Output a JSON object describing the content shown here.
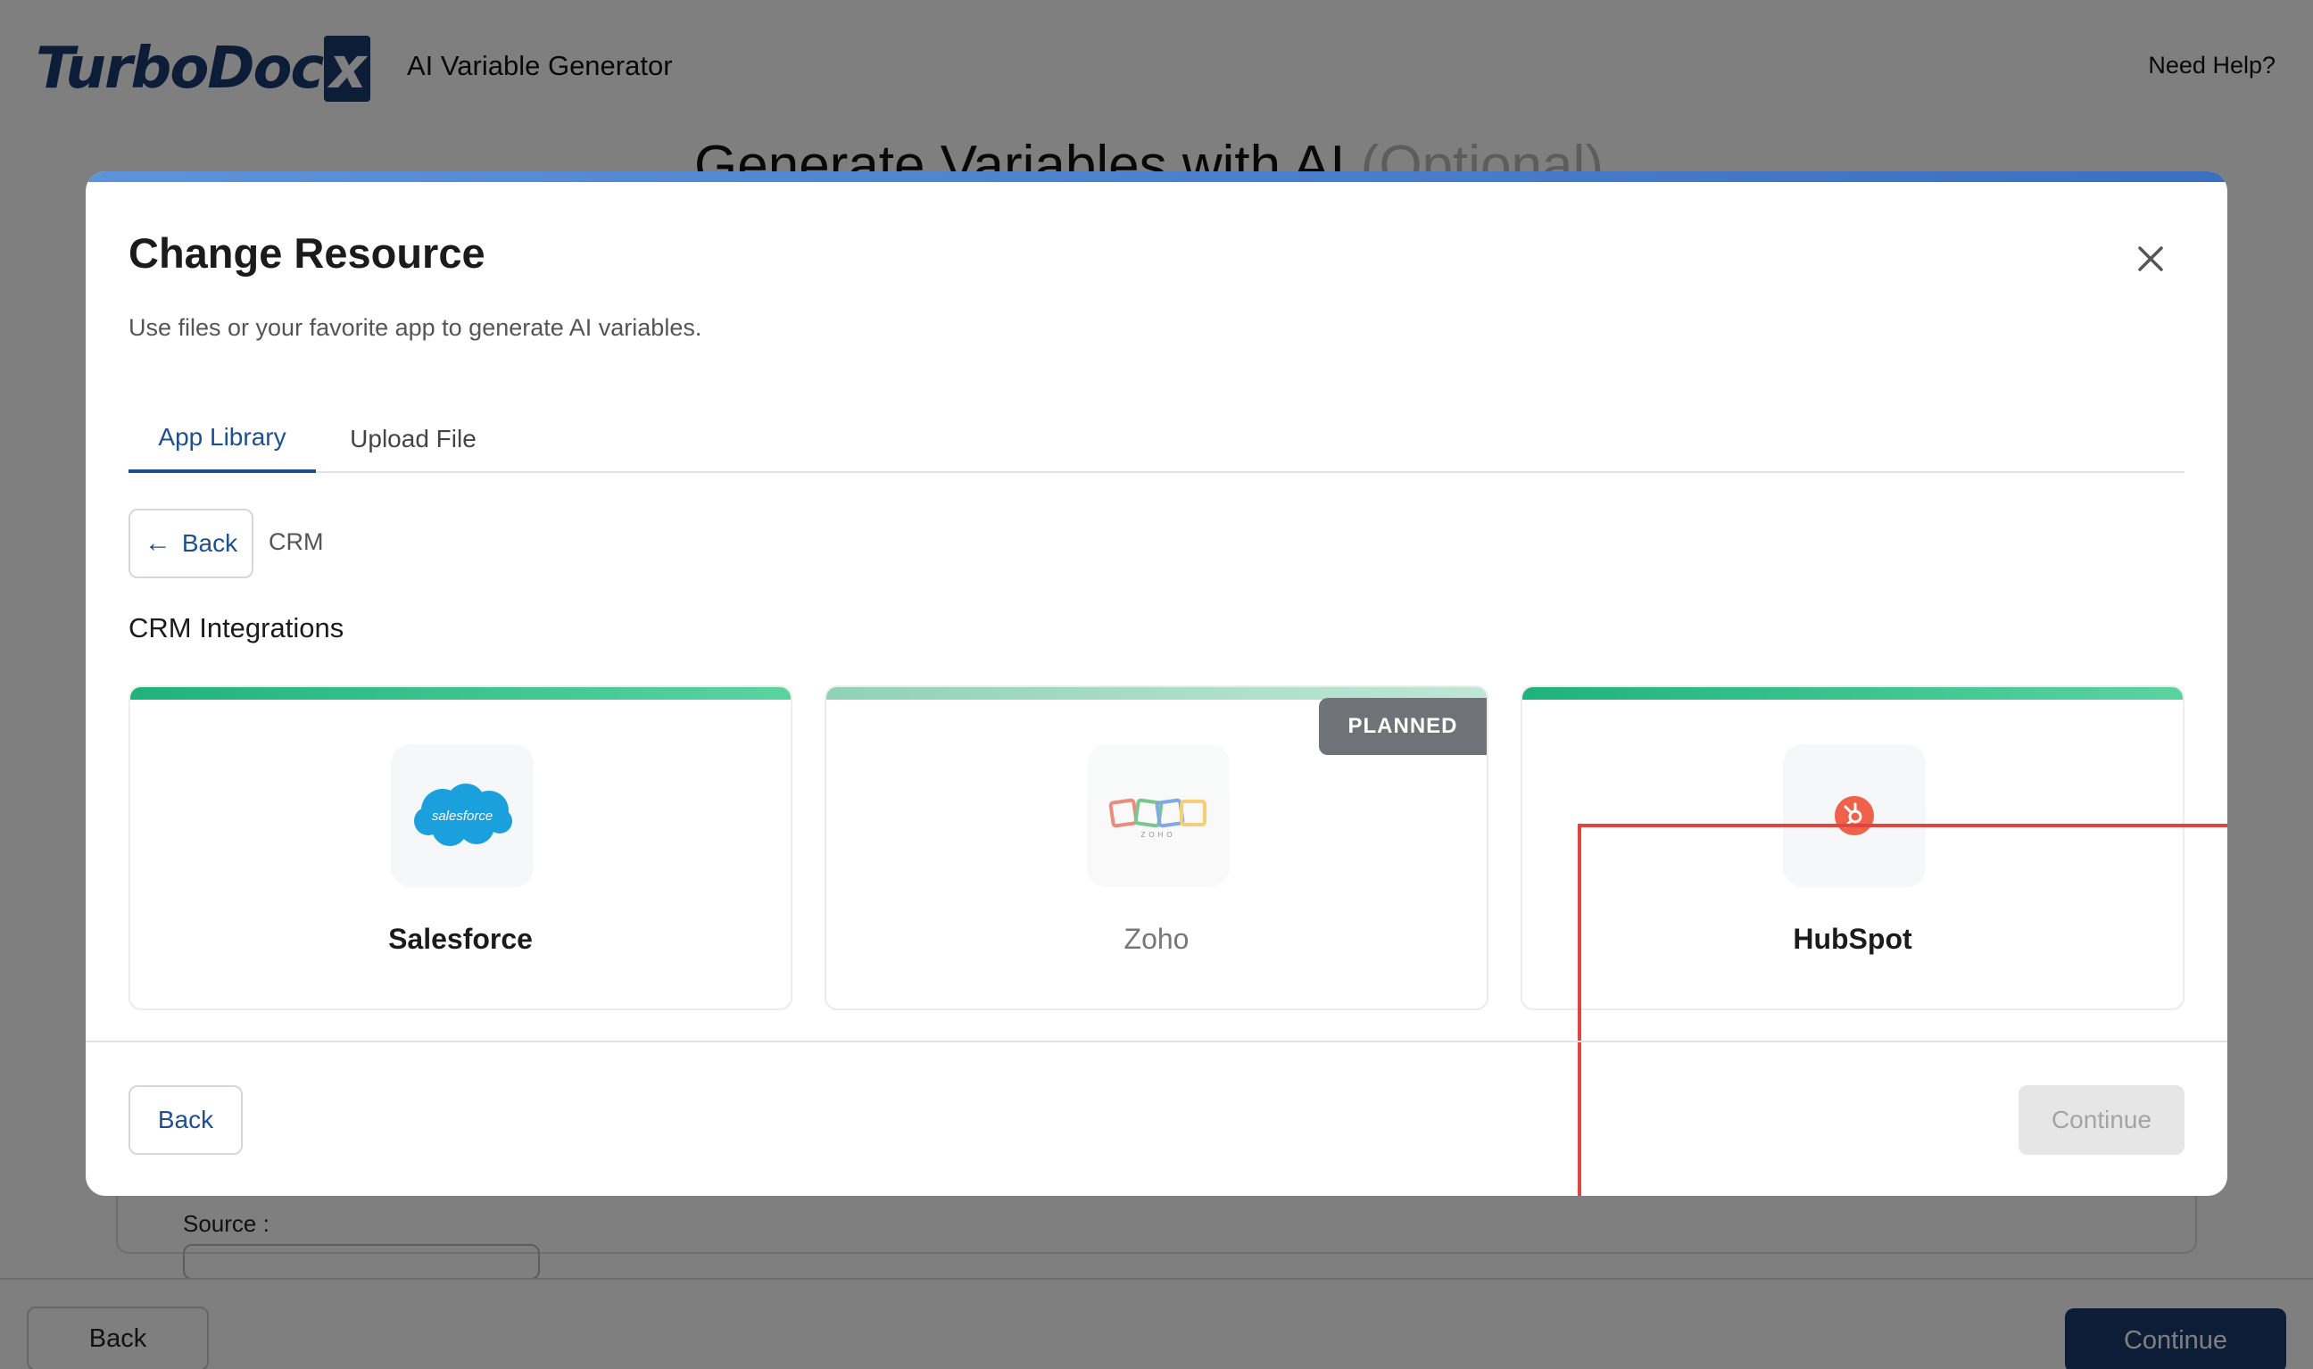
{
  "background": {
    "logo_text": "TurboDoc",
    "logo_x": "x",
    "page_title": "AI Variable Generator",
    "help_link": "Need Help?",
    "heading": "Generate Variables with AI",
    "heading_optional": "(Optional)",
    "source_label": "Source :",
    "back_button": "Back",
    "continue_button": "Continue"
  },
  "modal": {
    "title": "Change Resource",
    "subtitle": "Use files or your favorite app to generate AI variables.",
    "tabs": [
      {
        "label": "App Library",
        "active": true
      },
      {
        "label": "Upload File",
        "active": false
      }
    ],
    "back_label": "Back",
    "breadcrumb": "CRM",
    "section_label": "CRM Integrations",
    "cards": [
      {
        "name": "Salesforce",
        "icon": "salesforce-logo",
        "logo_text": "salesforce",
        "status": ""
      },
      {
        "name": "Zoho",
        "icon": "zoho-logo",
        "logo_text": "ZOHO",
        "status": "PLANNED"
      },
      {
        "name": "HubSpot",
        "icon": "hubspot-logo",
        "status": ""
      }
    ],
    "footer_back": "Back",
    "footer_continue": "Continue"
  },
  "colors": {
    "accent": "#1d4f91",
    "card_bar": "#1fb27e",
    "highlight": "#e0453f",
    "hubspot": "#f0614a",
    "salesforce": "#1aa0dd"
  }
}
